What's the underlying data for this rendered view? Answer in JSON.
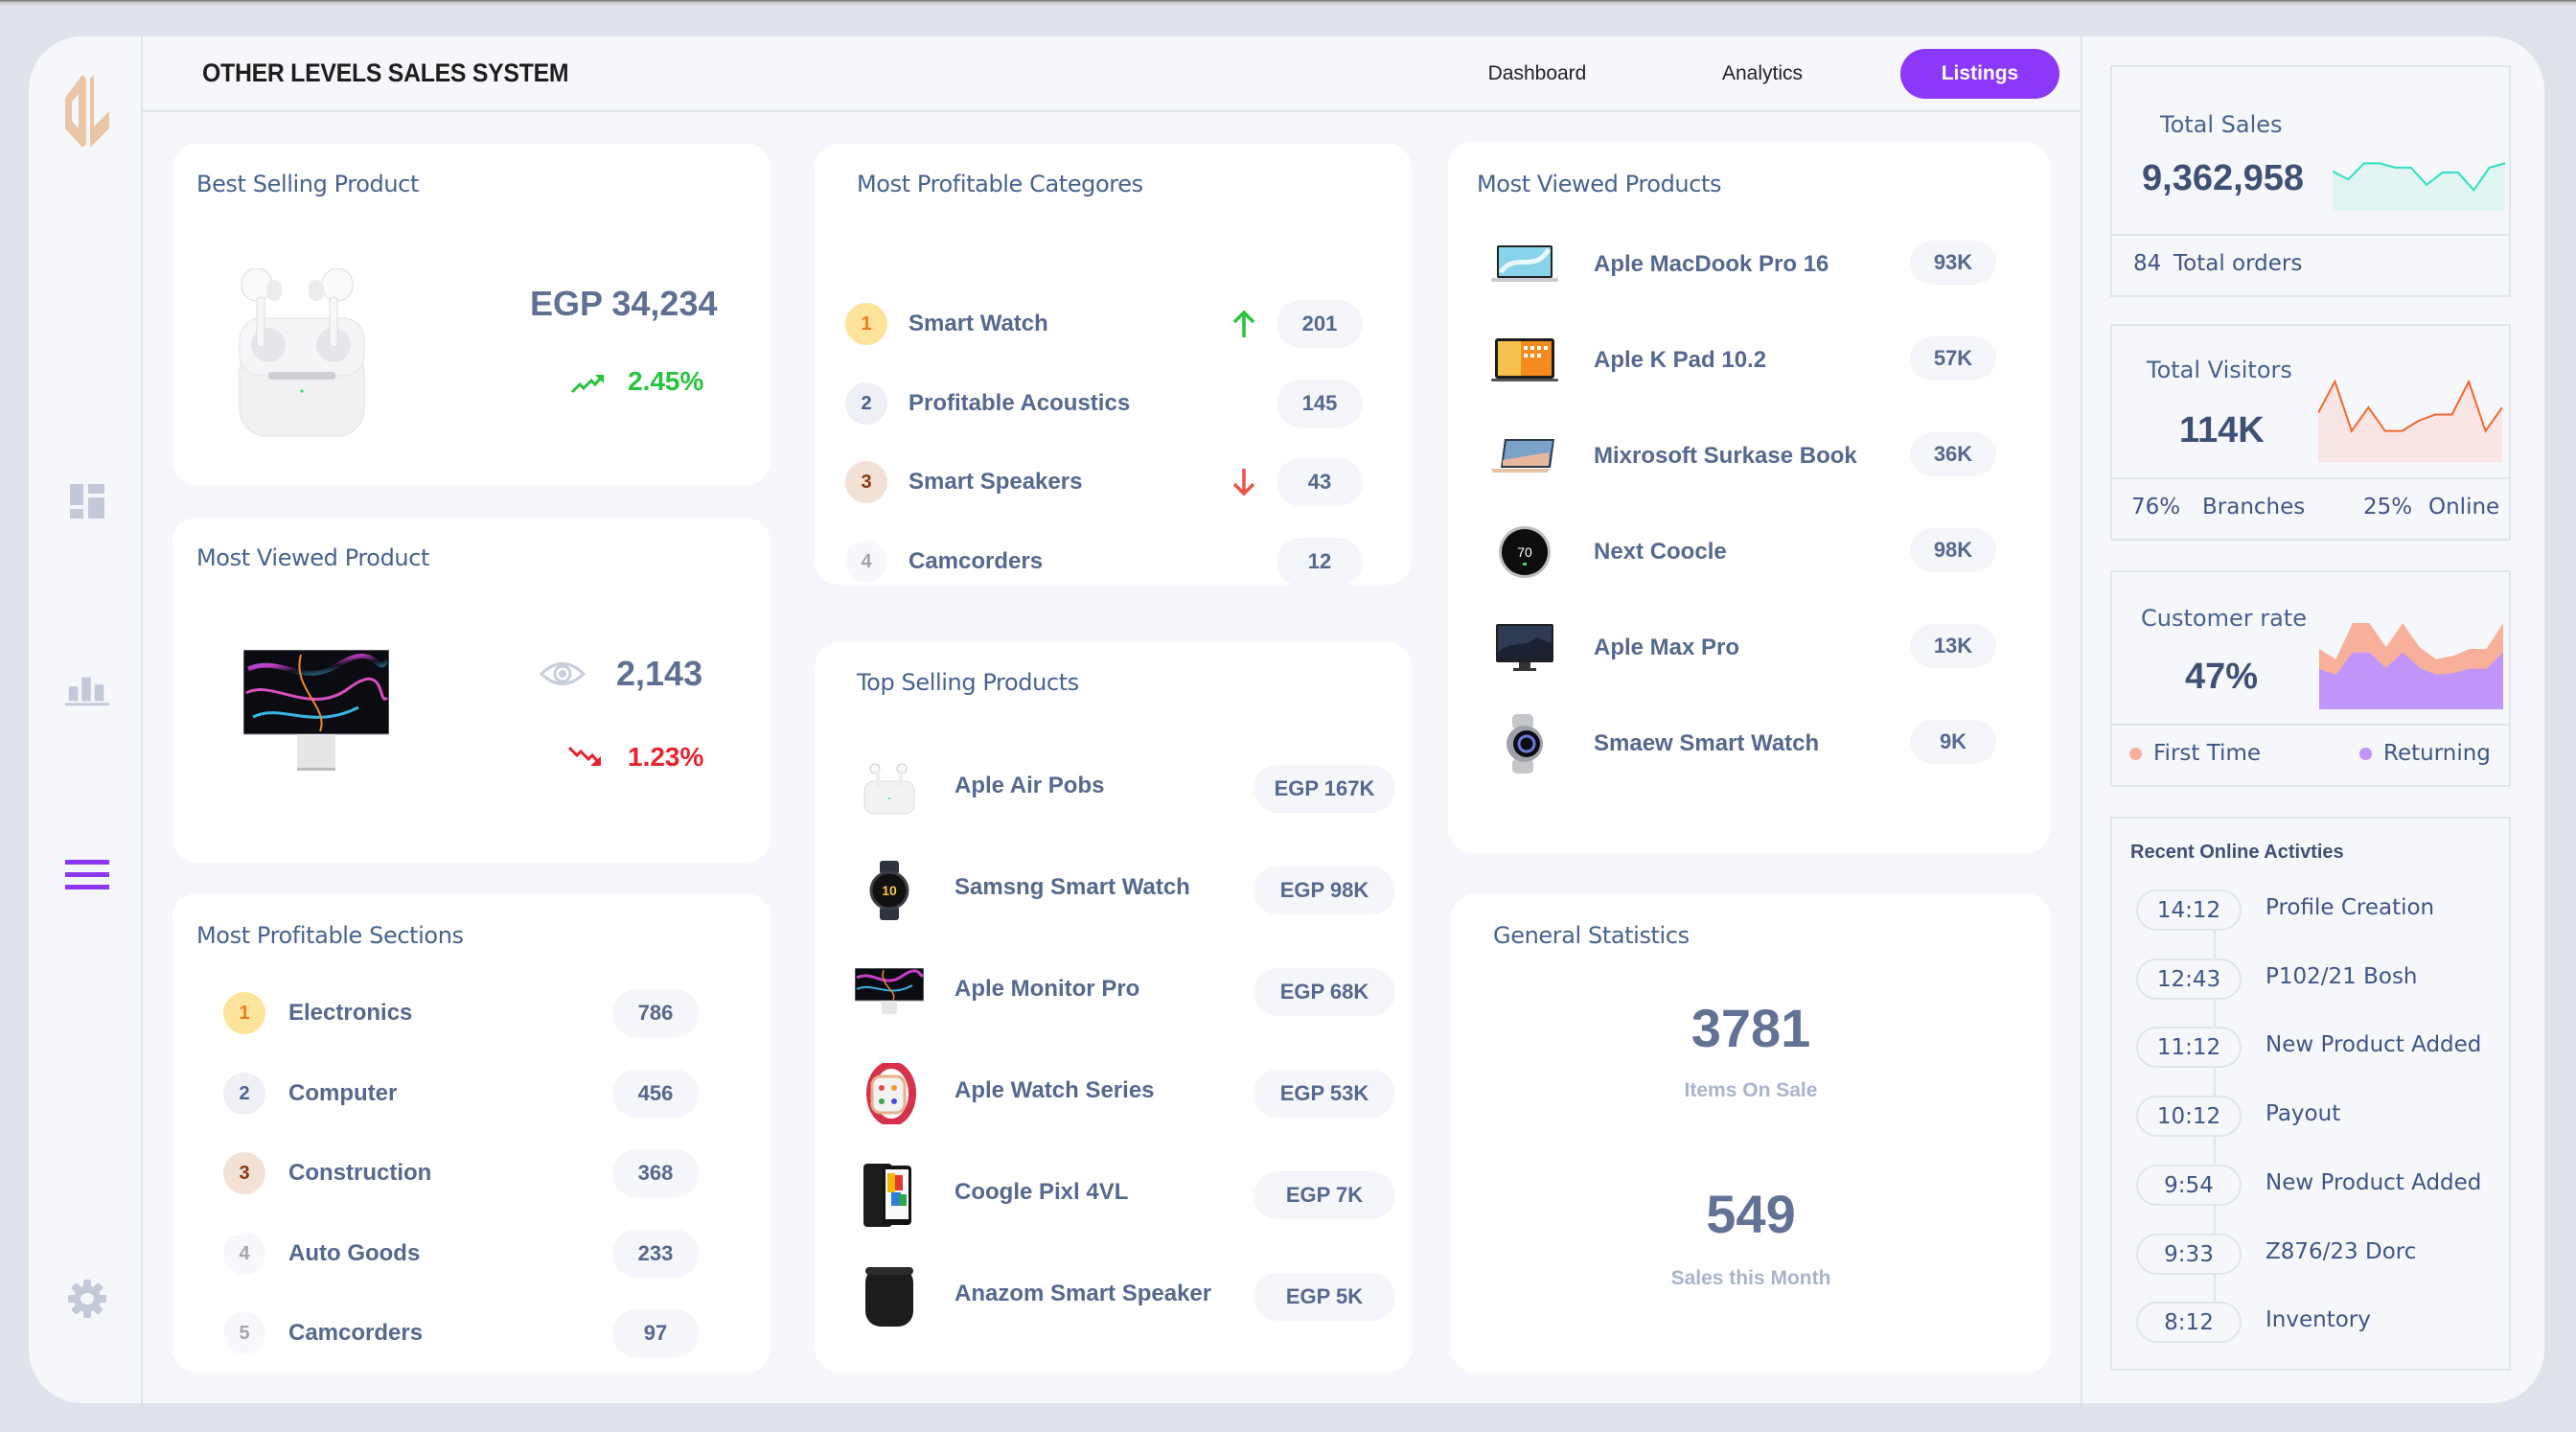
{
  "app": {
    "title": "OTHER LEVELS SALES SYSTEM",
    "logo": "OL-monogram-logo",
    "accent_color": "#8b38fb"
  },
  "sidebar": {
    "items": [
      {
        "icon": "dashboard-icon",
        "active": false
      },
      {
        "icon": "bar-chart-icon",
        "active": false
      },
      {
        "icon": "menu-icon",
        "active": true
      },
      {
        "icon": "gear-icon",
        "active": false
      }
    ]
  },
  "nav": {
    "tabs": [
      {
        "label": "Dashboard",
        "active": false
      },
      {
        "label": "Analytics",
        "active": false
      },
      {
        "label": "Listings",
        "active": true
      }
    ]
  },
  "best_selling": {
    "title": "Best Selling Product",
    "product_image": "airpods-image",
    "price": "EGP 34,234",
    "trend": "2.45%",
    "trend_direction": "up",
    "trend_color": "#27c33d"
  },
  "most_viewed_product": {
    "title": "Most Viewed Product",
    "product_image": "monitor-image",
    "views": "2,143",
    "trend": "1.23%",
    "trend_direction": "down",
    "trend_color": "#e8232e"
  },
  "profitable_sections": {
    "title": "Most Profitable Sections",
    "items": [
      {
        "rank": "1",
        "label": "Electronics",
        "value": "786"
      },
      {
        "rank": "2",
        "label": "Computer",
        "value": "456"
      },
      {
        "rank": "3",
        "label": "Construction",
        "value": "368"
      },
      {
        "rank": "4",
        "label": "Auto Goods",
        "value": "233"
      },
      {
        "rank": "5",
        "label": "Camcorders",
        "value": "97"
      }
    ]
  },
  "profitable_categories": {
    "title": "Most Profitable Categores",
    "items": [
      {
        "rank": "1",
        "label": "Smart Watch",
        "value": "201",
        "trend": "up"
      },
      {
        "rank": "2",
        "label": "Profitable Acoustics",
        "value": "145",
        "trend": ""
      },
      {
        "rank": "3",
        "label": "Smart Speakers",
        "value": "43",
        "trend": "down"
      },
      {
        "rank": "4",
        "label": "Camcorders",
        "value": "12",
        "trend": ""
      }
    ]
  },
  "top_selling": {
    "title": "Top Selling Products",
    "items": [
      {
        "label": "Aple Air Pobs",
        "value": "EGP 167K",
        "image": "airpods-image"
      },
      {
        "label": "Samsng Smart Watch",
        "value": "EGP 98K",
        "image": "smartwatch-image"
      },
      {
        "label": "Aple Monitor Pro",
        "value": "EGP 68K",
        "image": "monitor-image"
      },
      {
        "label": "Aple Watch Series",
        "value": "EGP 53K",
        "image": "apple-watch-image"
      },
      {
        "label": "Coogle Pixl 4VL",
        "value": "EGP 7K",
        "image": "phone-image"
      },
      {
        "label": "Anazom Smart Speaker",
        "value": "EGP 5K",
        "image": "speaker-image"
      }
    ]
  },
  "most_viewed_products": {
    "title": "Most Viewed Products",
    "items": [
      {
        "label": "Aple MacDook Pro 16",
        "value": "93K",
        "image": "laptop-image"
      },
      {
        "label": "Aple K Pad 10.2",
        "value": "57K",
        "image": "tablet-image"
      },
      {
        "label": "Mixrosoft Surkase Book",
        "value": "36K",
        "image": "surface-laptop-image"
      },
      {
        "label": "Next Coocle",
        "value": "98K",
        "image": "thermostat-image",
        "image_text": "70"
      },
      {
        "label": "Aple Max Pro",
        "value": "13K",
        "image": "imac-image"
      },
      {
        "label": "Smaew Smart Watch",
        "value": "9K",
        "image": "galaxy-watch-image"
      }
    ]
  },
  "general_stats": {
    "title": "General Statistics",
    "items": [
      {
        "value": "3781",
        "label": "Items On Sale"
      },
      {
        "value": "549",
        "label": "Sales this Month"
      }
    ]
  },
  "total_sales": {
    "label": "Total Sales",
    "value": "9,362,958",
    "footer_count": "84",
    "footer_label": "Total orders",
    "spark_color": "#2ee0c0",
    "spark_fill": "#e0f4f1",
    "spark": [
      0.7,
      0.55,
      0.85,
      0.85,
      0.77,
      0.77,
      0.45,
      0.68,
      0.68,
      0.35,
      0.77,
      0.85
    ]
  },
  "total_visitors": {
    "label": "Total Visitors",
    "value": "114K",
    "branches_pct": "76%",
    "branches_label": "Branches",
    "online_pct": "25%",
    "online_label": "Online",
    "spark_color": "#f3672f",
    "spark_fill": "#f9e5e4",
    "spark": [
      0.6,
      1.0,
      0.37,
      0.67,
      0.37,
      0.37,
      0.5,
      0.58,
      0.58,
      1.0,
      0.37,
      0.67
    ]
  },
  "customer_rate": {
    "label": "Customer rate",
    "value": "47%",
    "legend": [
      {
        "label": "First Time",
        "color": "#f9b09a"
      },
      {
        "label": "Returning",
        "color": "#c194fa"
      }
    ],
    "first_time": [
      0.7,
      0.58,
      1.0,
      1.0,
      0.72,
      1.0,
      0.72,
      0.58,
      0.62,
      0.7,
      0.7,
      1.0
    ],
    "returning": [
      0.47,
      0.4,
      0.66,
      0.66,
      0.48,
      0.66,
      0.48,
      0.4,
      0.42,
      0.47,
      0.47,
      0.66
    ]
  },
  "recent_activities": {
    "title": "Recent Online Activties",
    "items": [
      {
        "time": "14:12",
        "label": "Profile Creation"
      },
      {
        "time": "12:43",
        "label": "P102/21 Bosh"
      },
      {
        "time": "11:12",
        "label": "New Product Added"
      },
      {
        "time": "10:12",
        "label": "Payout"
      },
      {
        "time": "9:54",
        "label": "New Product Added"
      },
      {
        "time": "9:33",
        "label": "Z876/23 Dorc"
      },
      {
        "time": "8:12",
        "label": "Inventory"
      }
    ]
  }
}
